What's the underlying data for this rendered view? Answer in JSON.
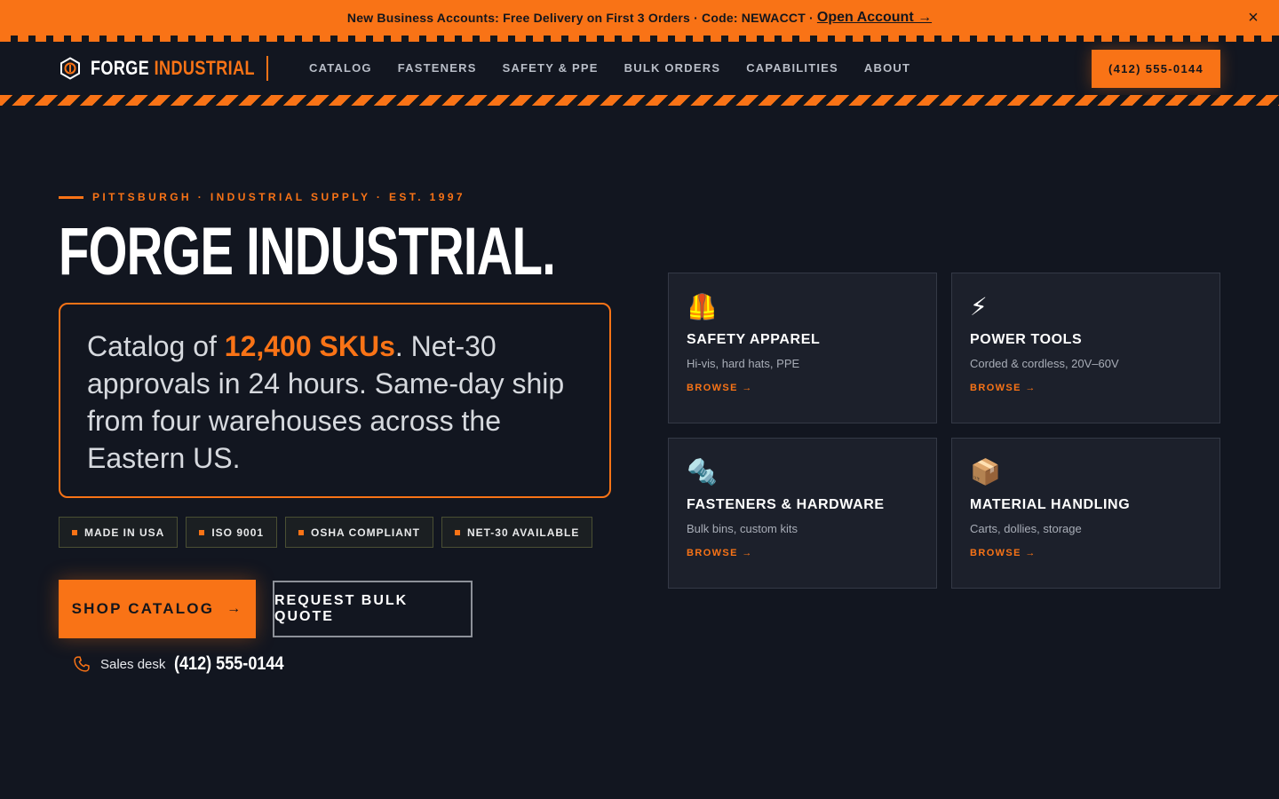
{
  "promo": {
    "text": "New Business Accounts: Free Delivery on First 3 Orders · Code: NEWACCT ·",
    "link": "Open Account →",
    "close": "×"
  },
  "header": {
    "brand_word1": "FORGE",
    "brand_word2": "INDUSTRIAL",
    "nav": [
      "CATALOG",
      "FASTENERS",
      "SAFETY & PPE",
      "BULK ORDERS",
      "CAPABILITIES",
      "ABOUT"
    ],
    "phone": "(412) 555-0144"
  },
  "hero": {
    "eyebrow": "PITTSBURGH · INDUSTRIAL SUPPLY · EST. 1997",
    "title": "FORGE INDUSTRIAL.",
    "lead_prefix": "Catalog of ",
    "lead_highlight": "12,400 SKUs",
    "lead_suffix": ". Net-30 approvals in 24 hours. Same-day ship from four warehouses across the Eastern US.",
    "badges": [
      "MADE IN USA",
      "ISO 9001",
      "OSHA COMPLIANT",
      "NET-30 AVAILABLE"
    ],
    "primary_cta": "SHOP CATALOG",
    "primary_cta_arrow": "→",
    "secondary_cta": "REQUEST BULK QUOTE",
    "sales_label": "Sales desk",
    "sales_number": "(412) 555-0144"
  },
  "categories": [
    {
      "icon": "safety-vest-icon",
      "glyph": "🦺",
      "title": "SAFETY APPAREL",
      "desc": "Hi-vis, hard hats, PPE",
      "link": "BROWSE →"
    },
    {
      "icon": "lightning-icon",
      "glyph": "⚡",
      "title": "POWER TOOLS",
      "desc": "Corded & cordless, 20V–60V",
      "link": "BROWSE →"
    },
    {
      "icon": "nut-and-bolt-icon",
      "glyph": "🔩",
      "title": "FASTENERS & HARDWARE",
      "desc": "Bulk bins, custom kits",
      "link": "BROWSE →"
    },
    {
      "icon": "package-icon",
      "glyph": "📦",
      "title": "MATERIAL HANDLING",
      "desc": "Carts, dollies, storage",
      "link": "BROWSE →"
    }
  ],
  "colors": {
    "accent": "#f97316",
    "background": "#121620",
    "card": "#1c202b"
  }
}
